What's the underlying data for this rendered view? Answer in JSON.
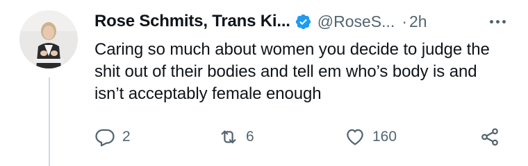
{
  "tweet": {
    "author_name": "Rose Schmits, Trans Ki...",
    "handle": "@RoseS...",
    "separator": "·",
    "time": "2h",
    "text": "Caring so much about women you decide to judge the shit out of their bodies and tell em who’s body is and isn’t acceptably female enough",
    "verified": true
  },
  "actions": {
    "replies": "2",
    "retweets": "6",
    "likes": "160"
  },
  "icons": {
    "reply": "reply-icon",
    "retweet": "retweet-icon",
    "like": "heart-icon",
    "share": "share-icon",
    "verified": "verified-badge-icon",
    "more": "more-options-icon"
  },
  "colors": {
    "text": "#0f1419",
    "secondary": "#536471",
    "verified": "#1d9bf0",
    "thread_line": "#cfd9de"
  }
}
